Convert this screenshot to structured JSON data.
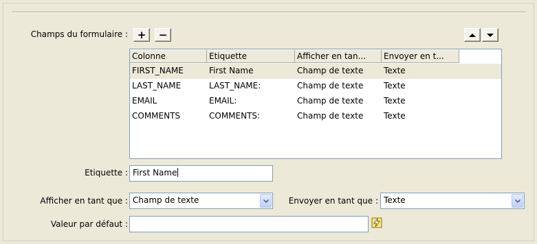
{
  "form_fields": {
    "label": "Champs du formulaire :",
    "add_label": "+",
    "remove_label": "−",
    "columns": [
      "Colonne",
      "Etiquette",
      "Afficher en tan...",
      "Envoyer en t..."
    ],
    "rows": [
      [
        "FIRST_NAME",
        "First Name",
        "Champ de texte",
        "Texte"
      ],
      [
        "LAST_NAME",
        "LAST_NAME:",
        "Champ de texte",
        "Texte"
      ],
      [
        "EMAIL",
        "EMAIL:",
        "Champ de texte",
        "Texte"
      ],
      [
        "COMMENTS",
        "COMMENTS:",
        "Champ de texte",
        "Texte"
      ]
    ],
    "selected_row": 0
  },
  "etiquette": {
    "label": "Etiquette :",
    "value": "First Name"
  },
  "afficher": {
    "label": "Afficher en tant que :",
    "value": "Champ de texte"
  },
  "envoyer": {
    "label": "Envoyer en tant que :",
    "value": "Texte"
  },
  "defaut": {
    "label": "Valeur par défaut :",
    "value": ""
  },
  "icons": {
    "move_up": "triangle-up-icon",
    "move_down": "triangle-down-icon",
    "dynamic_data": "lightning-icon",
    "dropdown": "chevron-down-icon"
  }
}
